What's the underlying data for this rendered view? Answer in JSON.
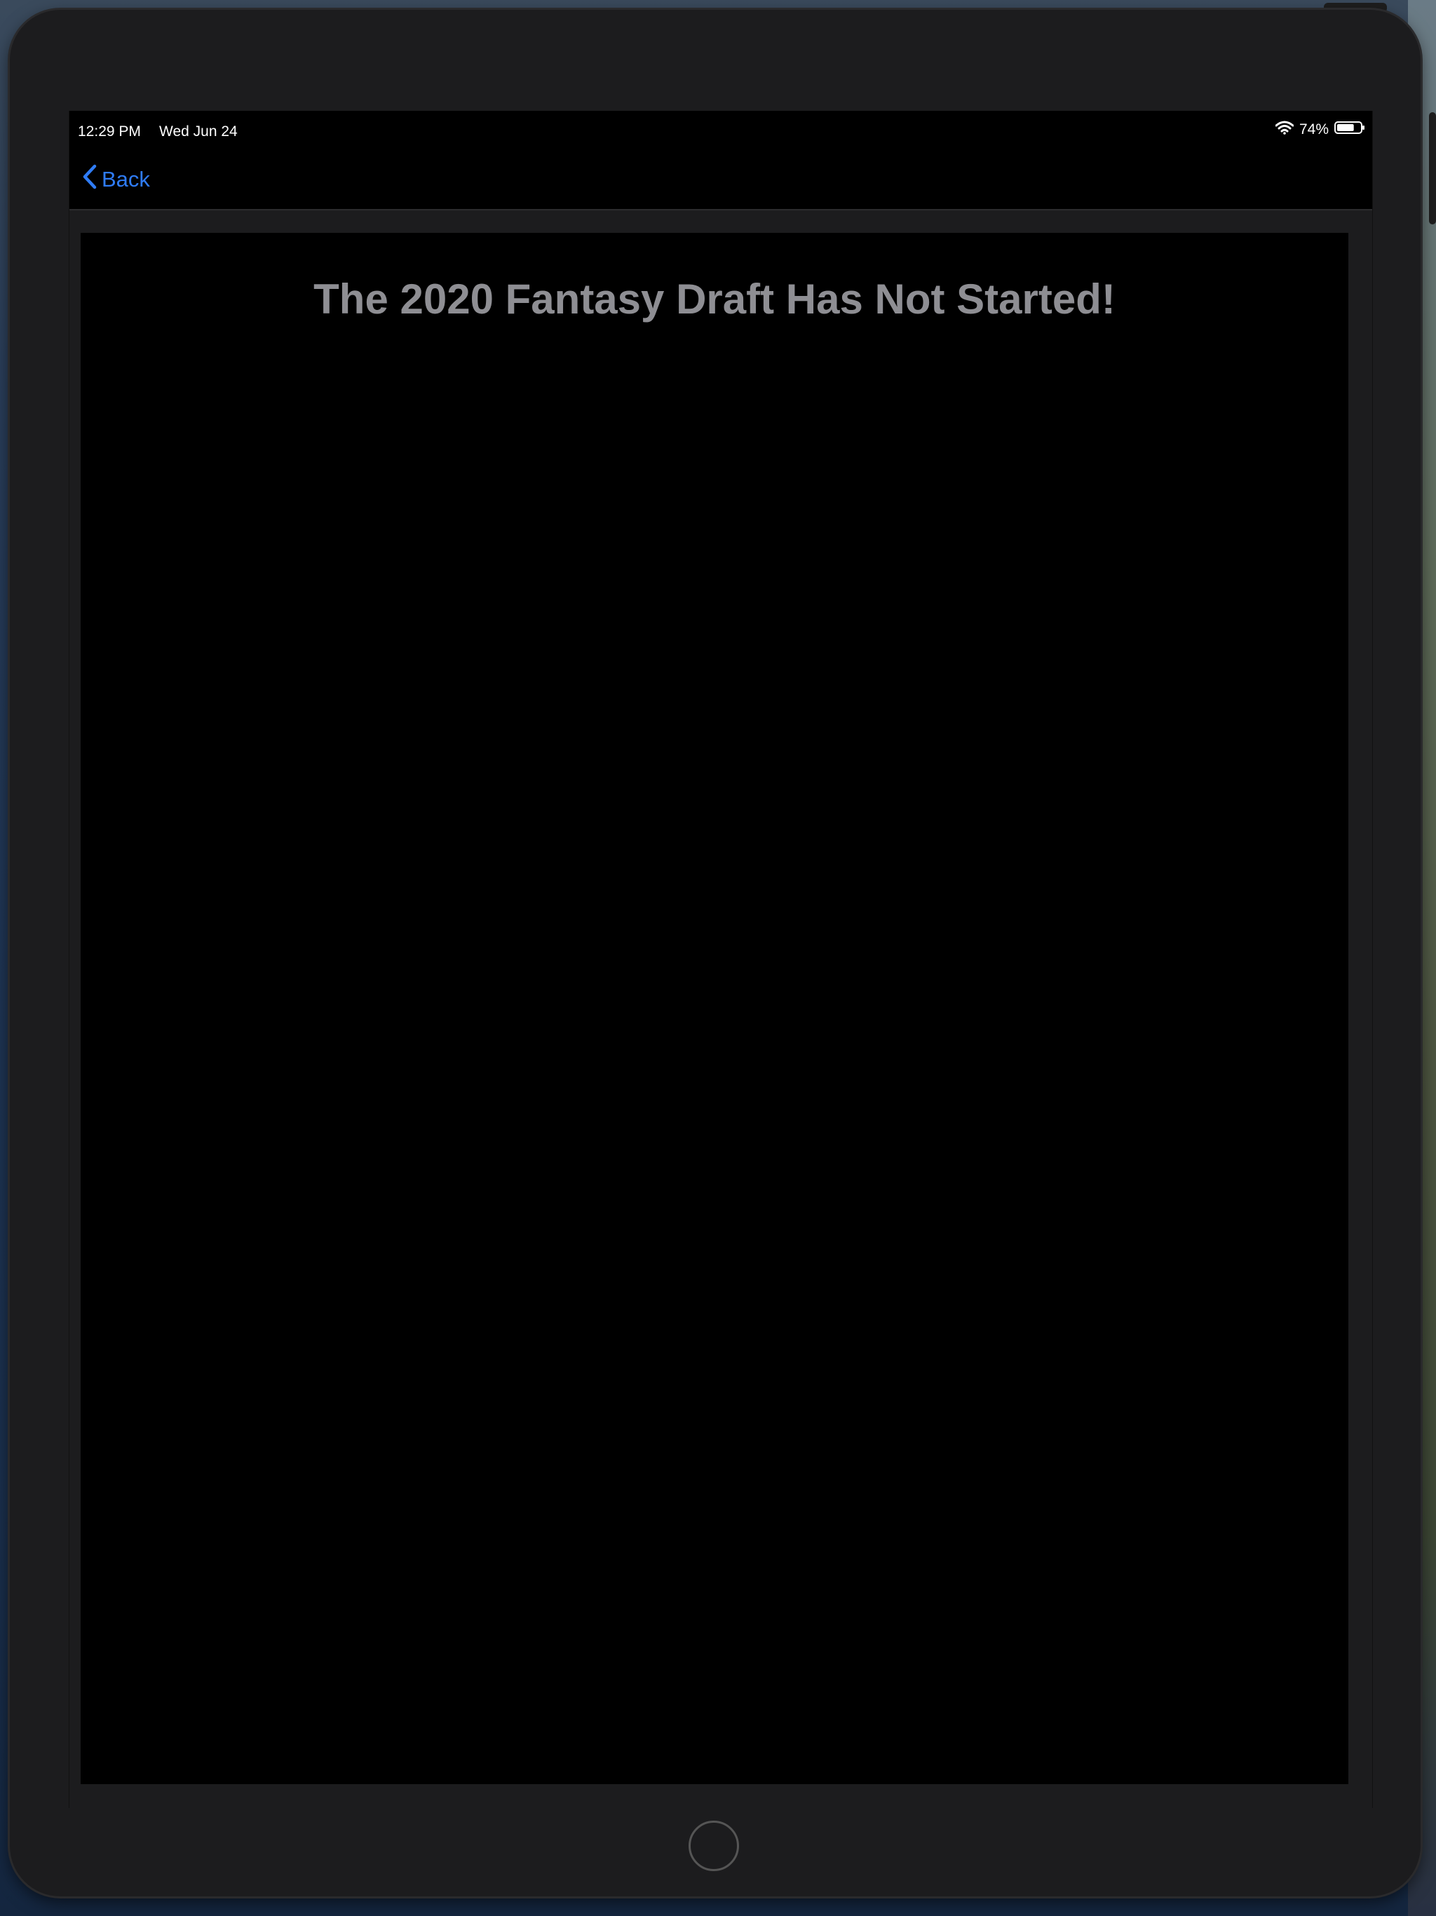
{
  "status_bar": {
    "time": "12:29 PM",
    "date": "Wed Jun 24",
    "battery_percent": "74%",
    "battery_level": 0.74,
    "icons": [
      "wifi-icon",
      "battery-icon"
    ]
  },
  "nav_bar": {
    "back_label": "Back",
    "back_icon": "chevron-left-icon",
    "accent_color": "#2f7cf6"
  },
  "main": {
    "message": "The 2020 Fantasy Draft Has Not Started!",
    "message_color": "#8e8e93",
    "background_color": "#000000"
  }
}
